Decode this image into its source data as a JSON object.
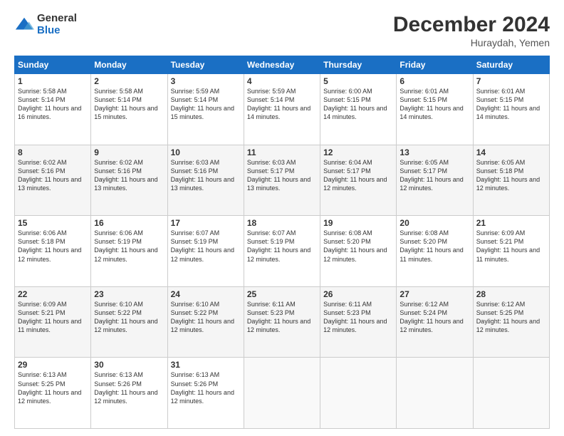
{
  "logo": {
    "general": "General",
    "blue": "Blue"
  },
  "title": "December 2024",
  "subtitle": "Huraydah, Yemen",
  "days_header": [
    "Sunday",
    "Monday",
    "Tuesday",
    "Wednesday",
    "Thursday",
    "Friday",
    "Saturday"
  ],
  "weeks": [
    [
      {
        "day": "1",
        "sunrise": "5:58 AM",
        "sunset": "5:14 PM",
        "daylight": "11 hours and 16 minutes."
      },
      {
        "day": "2",
        "sunrise": "5:58 AM",
        "sunset": "5:14 PM",
        "daylight": "11 hours and 15 minutes."
      },
      {
        "day": "3",
        "sunrise": "5:59 AM",
        "sunset": "5:14 PM",
        "daylight": "11 hours and 15 minutes."
      },
      {
        "day": "4",
        "sunrise": "5:59 AM",
        "sunset": "5:14 PM",
        "daylight": "11 hours and 14 minutes."
      },
      {
        "day": "5",
        "sunrise": "6:00 AM",
        "sunset": "5:15 PM",
        "daylight": "11 hours and 14 minutes."
      },
      {
        "day": "6",
        "sunrise": "6:01 AM",
        "sunset": "5:15 PM",
        "daylight": "11 hours and 14 minutes."
      },
      {
        "day": "7",
        "sunrise": "6:01 AM",
        "sunset": "5:15 PM",
        "daylight": "11 hours and 14 minutes."
      }
    ],
    [
      {
        "day": "8",
        "sunrise": "6:02 AM",
        "sunset": "5:16 PM",
        "daylight": "11 hours and 13 minutes."
      },
      {
        "day": "9",
        "sunrise": "6:02 AM",
        "sunset": "5:16 PM",
        "daylight": "11 hours and 13 minutes."
      },
      {
        "day": "10",
        "sunrise": "6:03 AM",
        "sunset": "5:16 PM",
        "daylight": "11 hours and 13 minutes."
      },
      {
        "day": "11",
        "sunrise": "6:03 AM",
        "sunset": "5:17 PM",
        "daylight": "11 hours and 13 minutes."
      },
      {
        "day": "12",
        "sunrise": "6:04 AM",
        "sunset": "5:17 PM",
        "daylight": "11 hours and 12 minutes."
      },
      {
        "day": "13",
        "sunrise": "6:05 AM",
        "sunset": "5:17 PM",
        "daylight": "11 hours and 12 minutes."
      },
      {
        "day": "14",
        "sunrise": "6:05 AM",
        "sunset": "5:18 PM",
        "daylight": "11 hours and 12 minutes."
      }
    ],
    [
      {
        "day": "15",
        "sunrise": "6:06 AM",
        "sunset": "5:18 PM",
        "daylight": "11 hours and 12 minutes."
      },
      {
        "day": "16",
        "sunrise": "6:06 AM",
        "sunset": "5:19 PM",
        "daylight": "11 hours and 12 minutes."
      },
      {
        "day": "17",
        "sunrise": "6:07 AM",
        "sunset": "5:19 PM",
        "daylight": "11 hours and 12 minutes."
      },
      {
        "day": "18",
        "sunrise": "6:07 AM",
        "sunset": "5:19 PM",
        "daylight": "11 hours and 12 minutes."
      },
      {
        "day": "19",
        "sunrise": "6:08 AM",
        "sunset": "5:20 PM",
        "daylight": "11 hours and 12 minutes."
      },
      {
        "day": "20",
        "sunrise": "6:08 AM",
        "sunset": "5:20 PM",
        "daylight": "11 hours and 11 minutes."
      },
      {
        "day": "21",
        "sunrise": "6:09 AM",
        "sunset": "5:21 PM",
        "daylight": "11 hours and 11 minutes."
      }
    ],
    [
      {
        "day": "22",
        "sunrise": "6:09 AM",
        "sunset": "5:21 PM",
        "daylight": "11 hours and 11 minutes."
      },
      {
        "day": "23",
        "sunrise": "6:10 AM",
        "sunset": "5:22 PM",
        "daylight": "11 hours and 12 minutes."
      },
      {
        "day": "24",
        "sunrise": "6:10 AM",
        "sunset": "5:22 PM",
        "daylight": "11 hours and 12 minutes."
      },
      {
        "day": "25",
        "sunrise": "6:11 AM",
        "sunset": "5:23 PM",
        "daylight": "11 hours and 12 minutes."
      },
      {
        "day": "26",
        "sunrise": "6:11 AM",
        "sunset": "5:23 PM",
        "daylight": "11 hours and 12 minutes."
      },
      {
        "day": "27",
        "sunrise": "6:12 AM",
        "sunset": "5:24 PM",
        "daylight": "11 hours and 12 minutes."
      },
      {
        "day": "28",
        "sunrise": "6:12 AM",
        "sunset": "5:25 PM",
        "daylight": "11 hours and 12 minutes."
      }
    ],
    [
      {
        "day": "29",
        "sunrise": "6:13 AM",
        "sunset": "5:25 PM",
        "daylight": "11 hours and 12 minutes."
      },
      {
        "day": "30",
        "sunrise": "6:13 AM",
        "sunset": "5:26 PM",
        "daylight": "11 hours and 12 minutes."
      },
      {
        "day": "31",
        "sunrise": "6:13 AM",
        "sunset": "5:26 PM",
        "daylight": "11 hours and 12 minutes."
      },
      null,
      null,
      null,
      null
    ]
  ],
  "labels": {
    "sunrise": "Sunrise:",
    "sunset": "Sunset:",
    "daylight": "Daylight:"
  }
}
